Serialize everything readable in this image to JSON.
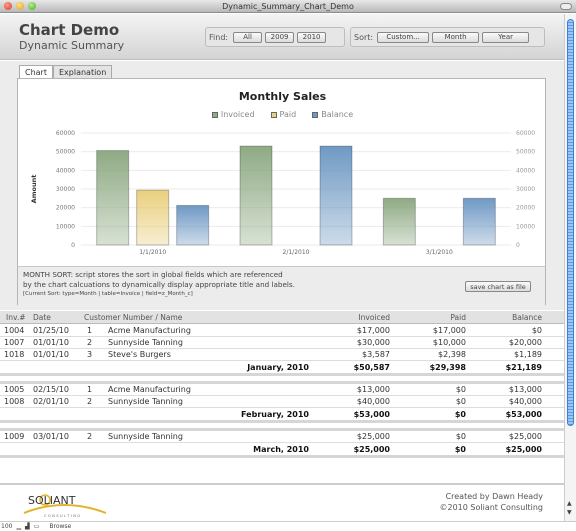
{
  "window": {
    "title": "Dynamic_Summary_Chart_Demo"
  },
  "header": {
    "title": "Chart Demo",
    "subtitle": "Dynamic Summary",
    "find": {
      "label": "Find:",
      "buttons": [
        "All",
        "2009",
        "2010"
      ]
    },
    "sort": {
      "label": "Sort:",
      "buttons": [
        "Custom...",
        "Month",
        "Year"
      ]
    }
  },
  "tabs": [
    {
      "label": "Chart",
      "active": true
    },
    {
      "label": "Explanation",
      "active": false
    }
  ],
  "colors": {
    "invoiced": "#8faa84",
    "paid": "#e9cf7e",
    "balance": "#6f99c4"
  },
  "chart_data": {
    "type": "bar",
    "title": "Monthly Sales",
    "categories": [
      "1/1/2010",
      "2/1/2010",
      "3/1/2010"
    ],
    "series": [
      {
        "name": "Invoiced",
        "values": [
          50587,
          53000,
          25000
        ]
      },
      {
        "name": "Paid",
        "values": [
          29398,
          0,
          0
        ]
      },
      {
        "name": "Balance",
        "values": [
          21189,
          53000,
          25000
        ]
      }
    ],
    "xlabel": "",
    "ylabel": "Amount",
    "ylim": [
      0,
      60000
    ],
    "yticks": [
      "0",
      "10000",
      "20000",
      "30000",
      "40000",
      "50000",
      "60000"
    ],
    "grid": true,
    "legend": "top-center"
  },
  "notes": {
    "line1": "MONTH SORT: script stores the sort in global fields which are referenced",
    "line2": "by the chart calcuations to dynamically display appropriate title and labels.",
    "current": "[Current Sort: type=Month | table=Invoice | field=z_Month_c]",
    "save_button": "save chart as file"
  },
  "table": {
    "headers": {
      "inv": "Inv.#",
      "date": "Date",
      "customer": "Customer Number / Name",
      "invoiced": "Invoiced",
      "paid": "Paid",
      "balance": "Balance"
    },
    "groups": [
      {
        "rows": [
          {
            "inv": "1004",
            "date": "01/25/10",
            "num": "1",
            "name": "Acme Manufacturing",
            "invoiced": "$17,000",
            "paid": "$17,000",
            "balance": "$0"
          },
          {
            "inv": "1007",
            "date": "01/01/10",
            "num": "2",
            "name": "Sunnyside Tanning",
            "invoiced": "$30,000",
            "paid": "$10,000",
            "balance": "$20,000"
          },
          {
            "inv": "1018",
            "date": "01/01/10",
            "num": "3",
            "name": "Steve's Burgers",
            "invoiced": "$3,587",
            "paid": "$2,398",
            "balance": "$1,189"
          }
        ],
        "summary": {
          "label": "January, 2010",
          "invoiced": "$50,587",
          "paid": "$29,398",
          "balance": "$21,189"
        }
      },
      {
        "rows": [
          {
            "inv": "1005",
            "date": "02/15/10",
            "num": "1",
            "name": "Acme Manufacturing",
            "invoiced": "$13,000",
            "paid": "$0",
            "balance": "$13,000"
          },
          {
            "inv": "1008",
            "date": "02/01/10",
            "num": "2",
            "name": "Sunnyside Tanning",
            "invoiced": "$40,000",
            "paid": "$0",
            "balance": "$40,000"
          }
        ],
        "summary": {
          "label": "February, 2010",
          "invoiced": "$53,000",
          "paid": "$0",
          "balance": "$53,000"
        }
      },
      {
        "rows": [
          {
            "inv": "1009",
            "date": "03/01/10",
            "num": "2",
            "name": "Sunnyside Tanning",
            "invoiced": "$25,000",
            "paid": "$0",
            "balance": "$25,000"
          }
        ],
        "summary": {
          "label": "March, 2010",
          "invoiced": "$25,000",
          "paid": "$0",
          "balance": "$25,000"
        }
      }
    ]
  },
  "footer": {
    "logo_name": "SOLIANT",
    "logo_sub": "CONSULTING",
    "credit1": "Created by Dawn Heady",
    "credit2": "©2010 Soliant Consulting"
  },
  "status": {
    "zoom": "100",
    "mode": "Browse"
  }
}
